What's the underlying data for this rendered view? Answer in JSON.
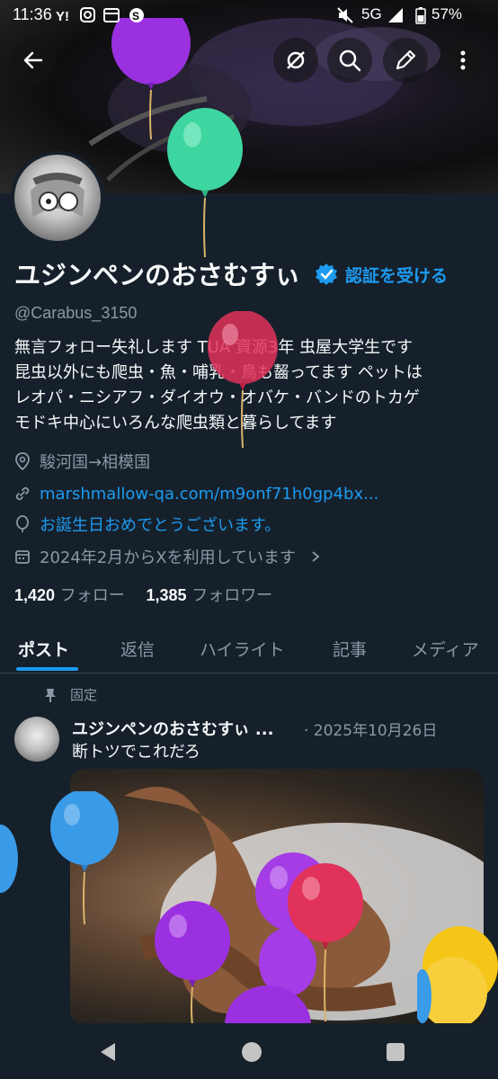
{
  "status_bar": {
    "time": "11:36",
    "network": "5G",
    "battery": "57%"
  },
  "profile": {
    "display_name": "ユジンペンのおさむすぃ",
    "verify_link": "認証を受ける",
    "handle": "@Carabus_3150",
    "bio_lines": [
      "無言フォロー失礼します TUA 資源3年 虫屋大学生です",
      "昆虫以外にも爬虫・魚・哺乳・鳥も齧ってます ペットは",
      "レオパ・ニシアフ・ダイオウ・オバケ・バンドのトカゲ",
      "モドキ中心にいろんな爬虫類と暮らしてます"
    ],
    "location": "駿河国→相模国",
    "website": "marshmallow-qa.com/m9onf71h0gp4bx...",
    "birthday": "お誕生日おめでとうございます。",
    "joined": "2024年2月からXを利用しています",
    "following_count": "1,420",
    "following_label": "フォロー",
    "followers_count": "1,385",
    "followers_label": "フォロワー"
  },
  "tabs": [
    {
      "label": "ポスト",
      "active": true
    },
    {
      "label": "返信",
      "active": false
    },
    {
      "label": "ハイライト",
      "active": false
    },
    {
      "label": "記事",
      "active": false
    },
    {
      "label": "メディア",
      "active": false
    }
  ],
  "pinned_post": {
    "pinned_label": "固定",
    "author": "ユジンペンのおさむすぃ ...",
    "date": "· 2025年10月26日",
    "text": "断トツでこれだろ"
  },
  "colors": {
    "background": "#15202b",
    "accent": "#1d9bf0",
    "secondary_text": "#8b98a5",
    "balloon_purple": "#9b30e0",
    "balloon_green": "#3ed6a0",
    "balloon_red": "#e0325a",
    "balloon_blue": "#3a9be8",
    "balloon_yellow": "#f5c518"
  }
}
